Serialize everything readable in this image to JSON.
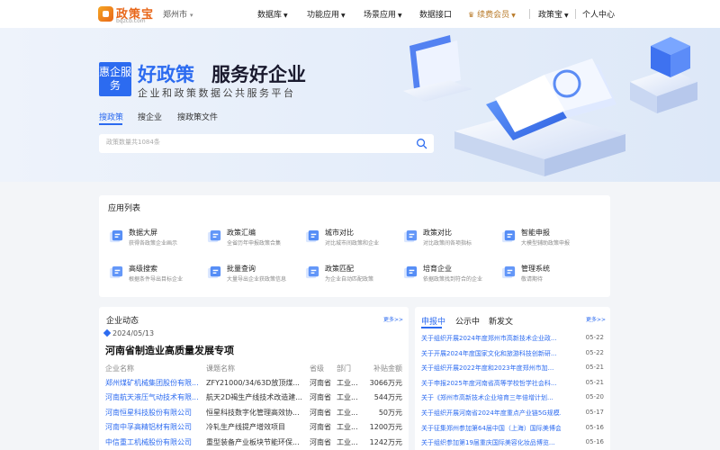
{
  "header": {
    "logo_text": "政策宝",
    "logo_sub": "bqzcb.com",
    "city": "郑州市",
    "nav": [
      "数据库",
      "功能应用",
      "场景应用",
      "数据接口",
      "续费会员",
      "政策宝",
      "个人中心"
    ]
  },
  "hero": {
    "badge": "惠企服务",
    "slogan_highlight": "好政策",
    "slogan": "服务好企业",
    "sub_slogan": "企业和政策数据公共服务平台",
    "tabs": [
      "搜政策",
      "搜企业",
      "搜政策文件"
    ],
    "search_placeholder": "政策数量共1084条"
  },
  "apps": {
    "title": "应用列表",
    "items": [
      {
        "name": "数据大屏",
        "desc": "获得各政策企业画示"
      },
      {
        "name": "政策汇编",
        "desc": "全省历年申报政策合集"
      },
      {
        "name": "城市对比",
        "desc": "对比城市间政策和企业"
      },
      {
        "name": "政策对比",
        "desc": "对比政策间各项指标"
      },
      {
        "name": "智能申报",
        "desc": "大模型辅助政策申报"
      },
      {
        "name": "高级搜索",
        "desc": "根据条件导出目标企业"
      },
      {
        "name": "批量查询",
        "desc": "大量导出企业获政策信息"
      },
      {
        "name": "政策匹配",
        "desc": "为企业自动匹配政策"
      },
      {
        "name": "培育企业",
        "desc": "依据政策找到符合的企业"
      },
      {
        "name": "管理系统",
        "desc": "敬请期待"
      }
    ]
  },
  "enterprise": {
    "title": "企业动态",
    "more": "更多>>",
    "date": "2024/05/13",
    "headline": "河南省制造业高质量发展专项",
    "columns": [
      "企业名称",
      "课题名称",
      "省级",
      "部门",
      "补贴金额"
    ],
    "rows": [
      [
        "郑州煤矿机械集团股份有限...",
        "ZFY21000/34/63D放顶煤...",
        "河南省",
        "工业...",
        "3066万元"
      ],
      [
        "河南航天液压气动技术有限...",
        "航天2D褐生产线技术改造建...",
        "河南省",
        "工业...",
        "544万元"
      ],
      [
        "河南恒星科技股份有限公司",
        "恒星科技数字化管理高效协...",
        "河南省",
        "工业...",
        "50万元"
      ],
      [
        "河南中孚高精铝材有限公司",
        "冷轧生产线提产增效项目",
        "河南省",
        "工业...",
        "1200万元"
      ],
      [
        "中信重工机械股份有限公司",
        "重型装备产业板块节能环保...",
        "河南省",
        "工业...",
        "1242万元"
      ]
    ]
  },
  "news": {
    "tabs": [
      "申报中",
      "公示中",
      "新发文"
    ],
    "more": "更多>>",
    "items": [
      {
        "title": "关于组织开展2024年度郑州市高新技术企业政...",
        "date": "05-22"
      },
      {
        "title": "关于开展2024年度国家文化和旅游科技创新研...",
        "date": "05-22"
      },
      {
        "title": "关于组织开展2022年度和2023年度郑州市加...",
        "date": "05-21"
      },
      {
        "title": "关于申报2025年度河南省高等学校哲学社会科...",
        "date": "05-21"
      },
      {
        "title": "关于《郑州市高新技术企业培育三年倍增计划...",
        "date": "05-20"
      },
      {
        "title": "关于组织开展河南省2024年度重点产业链5G规模...",
        "date": "05-17"
      },
      {
        "title": "关于征集郑州参加第64届中国（上海）国际美博会...",
        "date": "05-16"
      },
      {
        "title": "关于组织参加第19届重庆国际美容化妆品博览...",
        "date": "05-16"
      }
    ]
  },
  "colors": {
    "accent": "#2c6bf0",
    "brand": "#e8671a",
    "vip": "#b97b2a"
  }
}
